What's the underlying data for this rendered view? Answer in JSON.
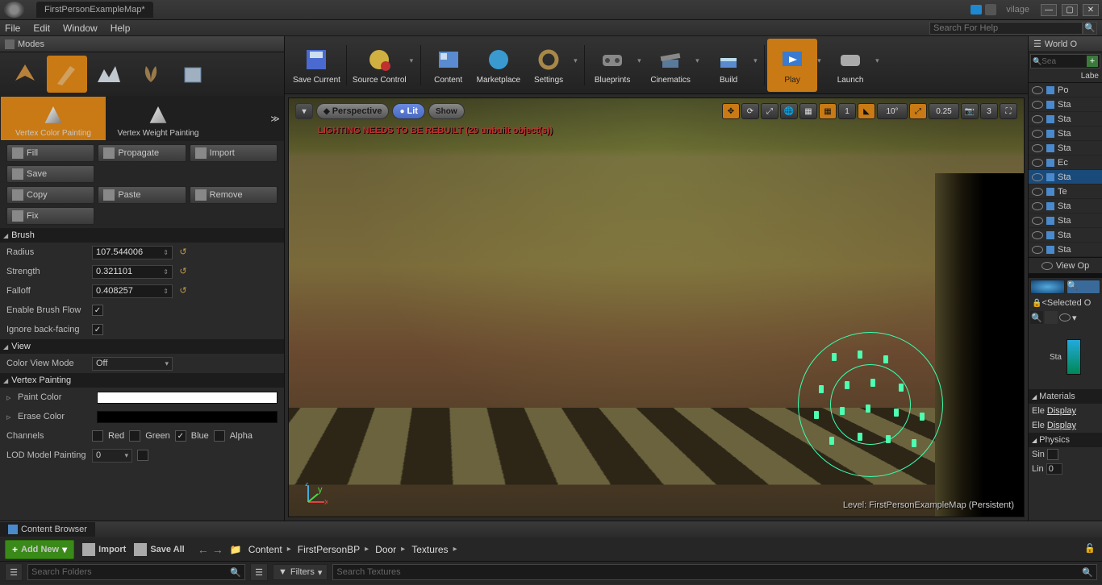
{
  "title": {
    "projectTab": "FirstPersonExampleMap*",
    "projectName": "vilage"
  },
  "menu": {
    "file": "File",
    "edit": "Edit",
    "window": "Window",
    "help": "Help",
    "searchPlaceholder": "Search For Help"
  },
  "modesPanel": {
    "title": "Modes",
    "submodes": {
      "vertexColor": "Vertex Color Painting",
      "vertexWeight": "Vertex Weight Painting"
    },
    "buttons": {
      "fill": "Fill",
      "propagate": "Propagate",
      "import": "Import",
      "save": "Save",
      "copy": "Copy",
      "paste": "Paste",
      "remove": "Remove",
      "fix": "Fix"
    },
    "brush": {
      "header": "Brush",
      "radiusLabel": "Radius",
      "radius": "107.544006",
      "strengthLabel": "Strength",
      "strength": "0.321101",
      "falloffLabel": "Falloff",
      "falloff": "0.408257",
      "flowLabel": "Enable Brush Flow",
      "backfaceLabel": "Ignore back-facing"
    },
    "view": {
      "header": "View",
      "colorViewLabel": "Color View Mode",
      "colorViewValue": "Off"
    },
    "vertexPainting": {
      "header": "Vertex Painting",
      "paintLabel": "Paint Color",
      "eraseLabel": "Erase Color",
      "channelsLabel": "Channels",
      "red": "Red",
      "green": "Green",
      "blue": "Blue",
      "alpha": "Alpha",
      "lodLabel": "LOD Model Painting",
      "lodValue": "0"
    }
  },
  "toolbar": {
    "save": "Save Current",
    "source": "Source Control",
    "content": "Content",
    "market": "Marketplace",
    "settings": "Settings",
    "blueprints": "Blueprints",
    "cinematics": "Cinematics",
    "build": "Build",
    "play": "Play",
    "launch": "Launch"
  },
  "viewport": {
    "perspective": "Perspective",
    "lit": "Lit",
    "show": "Show",
    "angle": "10°",
    "scale": "0.25",
    "snap1": "1",
    "camSpeed": "3",
    "warning": "LIGHTING NEEDS TO BE REBUILT (29 unbuilt object(s))",
    "level": "Level: FirstPersonExampleMap (Persistent)"
  },
  "outliner": {
    "title": "World O",
    "searchPlaceholder": "Sea",
    "labelHeader": "Labe",
    "items": [
      "Po",
      "Sta",
      "Sta",
      "Sta",
      "Sta",
      "Ec",
      "Sta",
      "Te",
      "Sta",
      "Sta",
      "Sta",
      "Sta"
    ],
    "selectedIndex": 6,
    "viewOptions": "View Op"
  },
  "details": {
    "selectedLabel": "<Selected O",
    "staticLabel": "Sta",
    "materials": "Materials",
    "ele": "Ele",
    "display": "Display",
    "physics": "Physics",
    "sin": "Sin",
    "lin": "Lin",
    "zero": "0"
  },
  "contentBrowser": {
    "tab": "Content Browser",
    "addNew": "Add New",
    "import": "Import",
    "saveAll": "Save All",
    "path": [
      "Content",
      "FirstPersonBP",
      "Door",
      "Textures"
    ],
    "filters": "Filters",
    "searchFolders": "Search Folders",
    "searchTextures": "Search Textures"
  }
}
